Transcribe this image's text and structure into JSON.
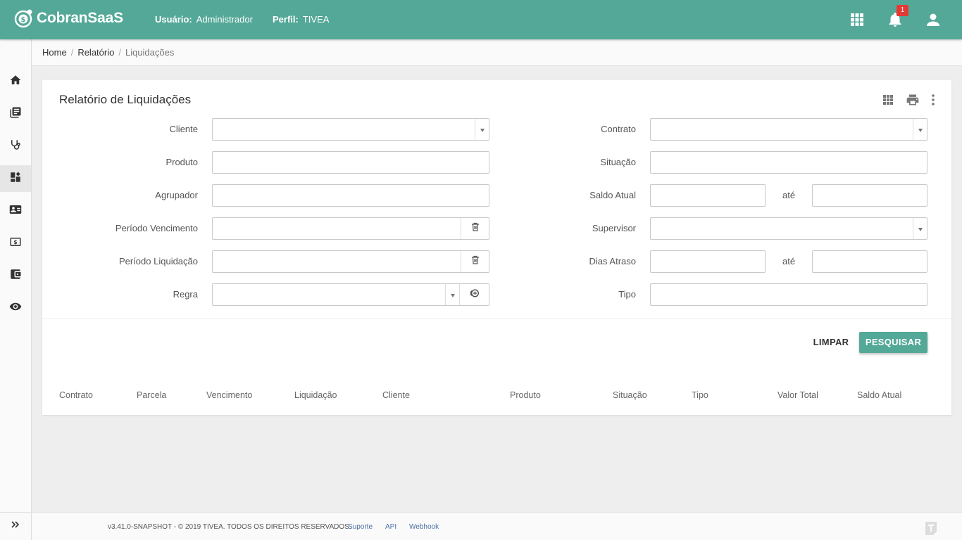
{
  "app": {
    "name": "CobranSaaS"
  },
  "header": {
    "user_label": "Usuário:",
    "user_value": "Administrador",
    "profile_label": "Perfil:",
    "profile_value": "TIVEA",
    "notification_count": "1"
  },
  "breadcrumb": {
    "home": "Home",
    "section": "Relatório",
    "current": "Liquidações"
  },
  "card": {
    "title": "Relatório de Liquidações"
  },
  "form": {
    "cliente": "Cliente",
    "produto": "Produto",
    "agrupador": "Agrupador",
    "periodo_vencimento": "Período Vencimento",
    "periodo_liquidacao": "Período Liquidação",
    "regra": "Regra",
    "contrato": "Contrato",
    "situacao": "Situação",
    "saldo_atual": "Saldo Atual",
    "supervisor": "Supervisor",
    "dias_atraso": "Dias Atraso",
    "tipo": "Tipo",
    "ate": "até"
  },
  "actions": {
    "limpar": "LIMPAR",
    "pesquisar": "PESQUISAR"
  },
  "table": {
    "headers": [
      "Contrato",
      "Parcela",
      "Vencimento",
      "Liquidação",
      "Cliente",
      "Produto",
      "Situação",
      "Tipo",
      "Valor Total",
      "Saldo Atual"
    ]
  },
  "footer": {
    "copyright": "v3.41.0-SNAPSHOT - © 2019 TIVEA. TODOS OS DIREITOS RESERVADOS.",
    "links": [
      "Suporte",
      "API",
      "Webhook"
    ]
  },
  "colors": {
    "primary": "#54a898",
    "badge": "#e53935",
    "link": "#4a6fa5"
  },
  "icons": {
    "sidebar": [
      "home-icon",
      "book-icon",
      "stethoscope-icon",
      "dashboard-icon",
      "contact-card-icon",
      "money-icon",
      "wallet-icon",
      "eye-icon"
    ],
    "header": [
      "apps-grid-icon",
      "bell-icon",
      "user-icon"
    ],
    "card_tools": [
      "grid-icon",
      "print-icon",
      "more-vert-icon"
    ]
  }
}
